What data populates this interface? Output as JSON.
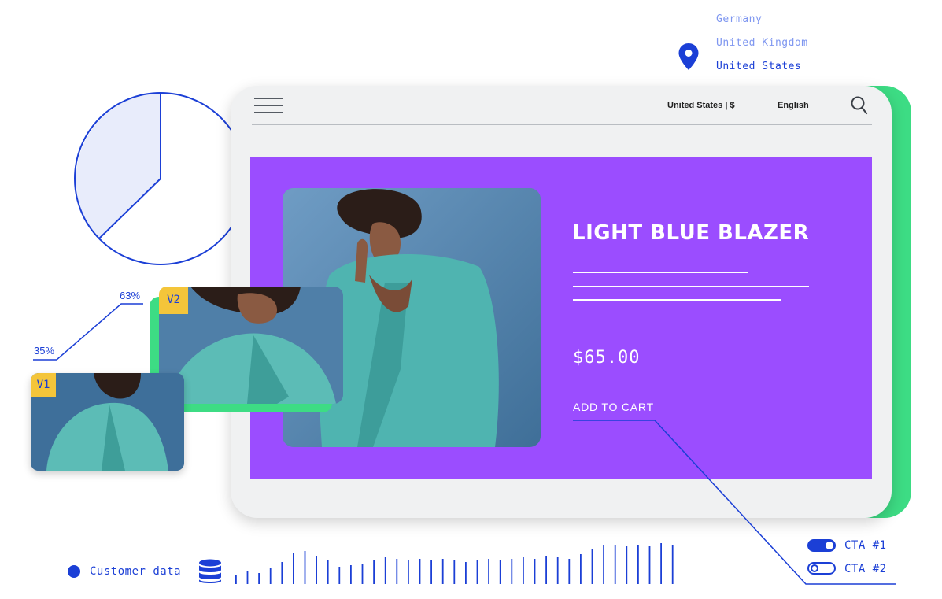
{
  "locations": {
    "items": [
      "Germany",
      "United Kingdom",
      "United States"
    ],
    "selected": "United States"
  },
  "navbar": {
    "region_label": "United States | $",
    "language_label": "English"
  },
  "product": {
    "title": "LIGHT BLUE BLAZER",
    "price": "$65.00",
    "cta_label": "ADD TO CART"
  },
  "variants": {
    "v1": {
      "label": "V1",
      "share": "35%"
    },
    "v2": {
      "label": "V2",
      "share": "63%"
    }
  },
  "cta_toggles": [
    {
      "label": "CTA #1",
      "on": true
    },
    {
      "label": "CTA #2",
      "on": false
    }
  ],
  "data_source": {
    "label": "Customer data"
  },
  "colors": {
    "accent_blue": "#1b3fd6",
    "hero_purple": "#9b4dff",
    "device_green": "#3ddc84",
    "variant_tag": "#f4c53a"
  }
}
